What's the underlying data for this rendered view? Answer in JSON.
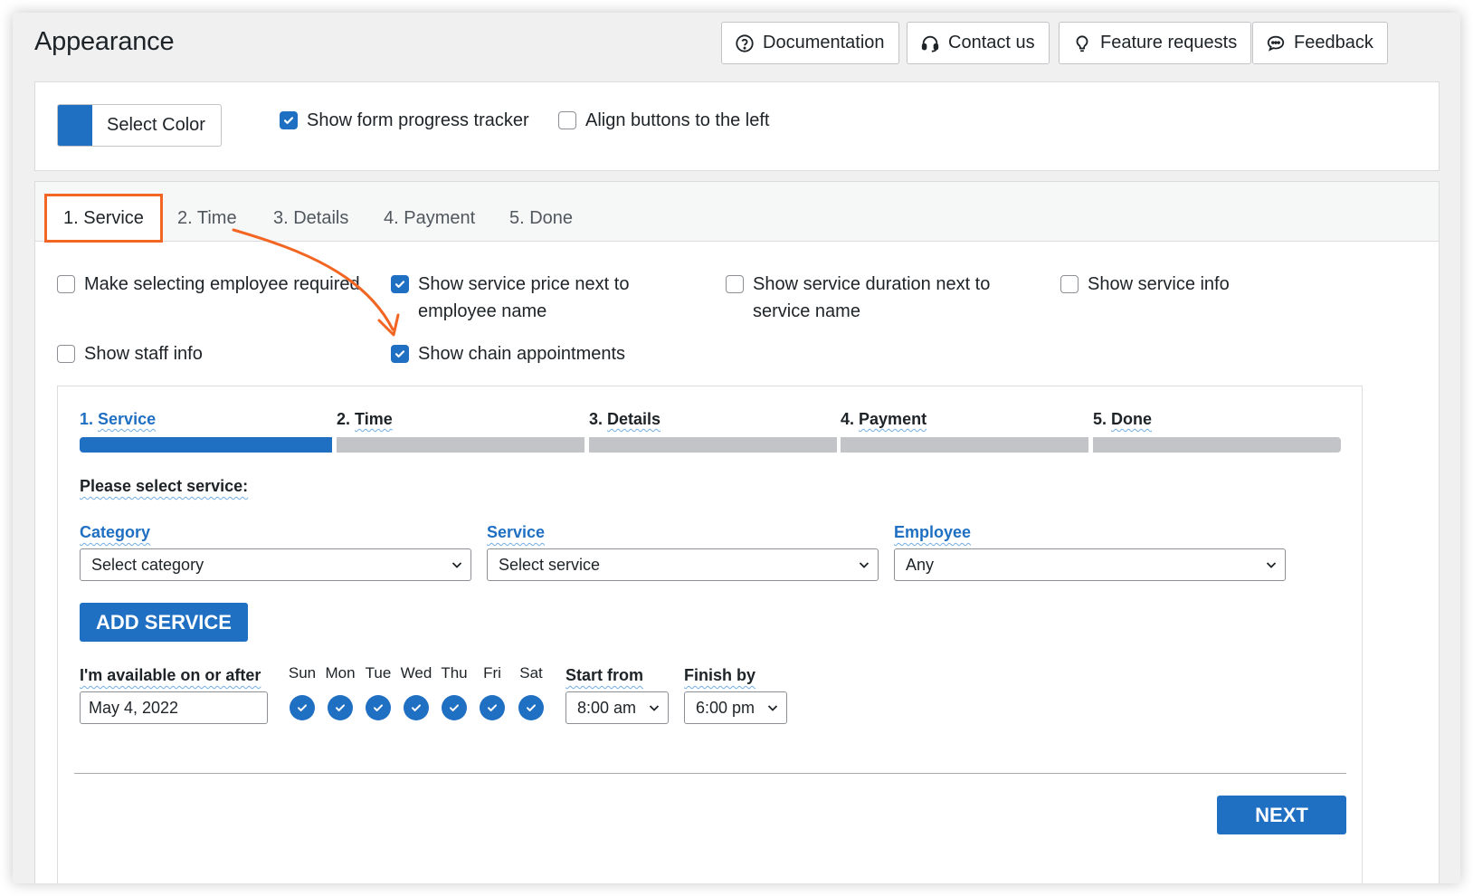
{
  "header": {
    "title": "Appearance",
    "buttons": {
      "documentation": "Documentation",
      "contact": "Contact us",
      "feature_requests": "Feature requests",
      "feedback": "Feedback"
    }
  },
  "top_settings": {
    "select_color_label": "Select Color",
    "color": "#1f6fc2",
    "show_progress_tracker": {
      "label": "Show form progress tracker",
      "checked": true
    },
    "align_buttons_left": {
      "label": "Align buttons to the left",
      "checked": false
    }
  },
  "tabs": [
    "1. Service",
    "2. Time",
    "3. Details",
    "4. Payment",
    "5. Done"
  ],
  "active_tab": "1. Service",
  "service_options": {
    "employee_required": {
      "label": "Make selecting employee required",
      "checked": false
    },
    "price_next_to_employee": {
      "line1": "Show service price next to",
      "line2": "employee name",
      "checked": true
    },
    "duration_next_to_service": {
      "line1": "Show service duration next to",
      "line2": "service name",
      "checked": false
    },
    "service_info": {
      "label": "Show service info",
      "checked": false
    },
    "staff_info": {
      "label": "Show staff info",
      "checked": false
    },
    "chain_appointments": {
      "label": "Show chain appointments",
      "checked": true
    }
  },
  "preview": {
    "steps": [
      {
        "num": "1.",
        "name": "Service"
      },
      {
        "num": "2.",
        "name": "Time"
      },
      {
        "num": "3.",
        "name": "Details"
      },
      {
        "num": "4.",
        "name": "Payment"
      },
      {
        "num": "5.",
        "name": "Done"
      }
    ],
    "current_step": 1,
    "prompt": "Please select service:",
    "category": {
      "label": "Category",
      "value": "Select category"
    },
    "service": {
      "label": "Service",
      "value": "Select service"
    },
    "employee": {
      "label": "Employee",
      "value": "Any"
    },
    "add_service": "ADD SERVICE",
    "available_label": "I'm available on or after",
    "date": "May 4, 2022",
    "days": [
      "Sun",
      "Mon",
      "Tue",
      "Wed",
      "Thu",
      "Fri",
      "Sat"
    ],
    "days_checked": [
      true,
      true,
      true,
      true,
      true,
      true,
      true
    ],
    "start_from": {
      "label": "Start from",
      "value": "8:00 am"
    },
    "finish_by": {
      "label": "Finish by",
      "value": "6:00 pm"
    },
    "next": "NEXT"
  },
  "colors": {
    "accent": "#1f6fc2",
    "highlight": "#f26522"
  }
}
